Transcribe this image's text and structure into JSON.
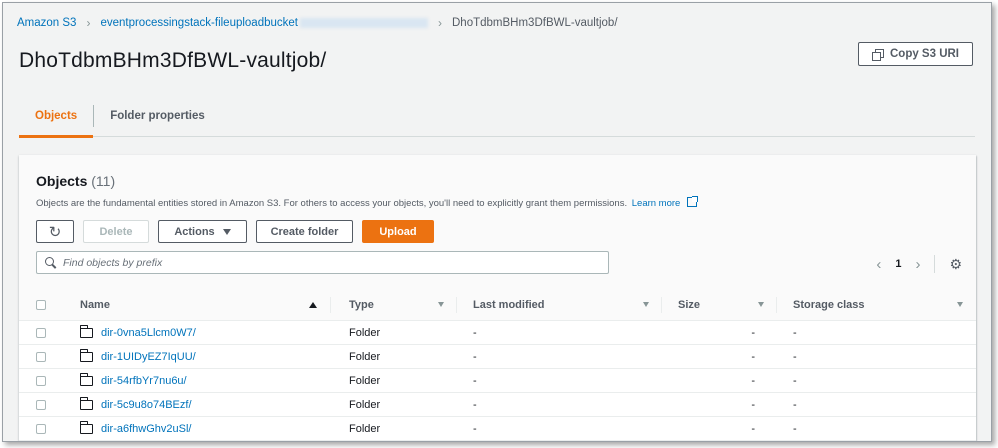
{
  "breadcrumb": {
    "root": "Amazon S3",
    "bucket": "eventprocessingstack-fileuploadbucket",
    "current": "DhoTdbmBHm3DfBWL-vaultjob/"
  },
  "page": {
    "title": "DhoTdbmBHm3DfBWL-vaultjob/",
    "copy_button": "Copy S3 URI"
  },
  "tabs": [
    {
      "label": "Objects",
      "active": true
    },
    {
      "label": "Folder properties",
      "active": false
    }
  ],
  "objects_panel": {
    "title": "Objects",
    "count": "(11)",
    "description": "Objects are the fundamental entities stored in Amazon S3. For others to access your objects, you'll need to explicitly grant them permissions.",
    "learn_more": "Learn more",
    "buttons": {
      "delete": "Delete",
      "actions": "Actions",
      "create_folder": "Create folder",
      "upload": "Upload"
    },
    "search_placeholder": "Find objects by prefix",
    "page_number": "1"
  },
  "table": {
    "columns": [
      "Name",
      "Type",
      "Last modified",
      "Size",
      "Storage class"
    ],
    "rows": [
      {
        "name": "dir-0vna5Llcm0W7/",
        "type": "Folder",
        "last_modified": "-",
        "size": "-",
        "storage_class": "-"
      },
      {
        "name": "dir-1UIDyEZ7IqUU/",
        "type": "Folder",
        "last_modified": "-",
        "size": "-",
        "storage_class": "-"
      },
      {
        "name": "dir-54rfbYr7nu6u/",
        "type": "Folder",
        "last_modified": "-",
        "size": "-",
        "storage_class": "-"
      },
      {
        "name": "dir-5c9u8o74BEzf/",
        "type": "Folder",
        "last_modified": "-",
        "size": "-",
        "storage_class": "-"
      },
      {
        "name": "dir-a6fhwGhv2uSl/",
        "type": "Folder",
        "last_modified": "-",
        "size": "-",
        "storage_class": "-"
      }
    ]
  },
  "colors": {
    "accent": "#ec7211",
    "link": "#0073bb"
  }
}
